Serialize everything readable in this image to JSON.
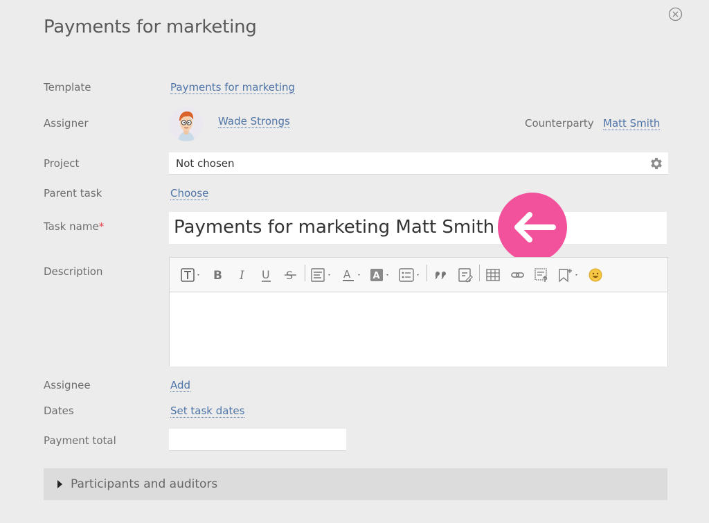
{
  "dialog": {
    "title": "Payments for marketing"
  },
  "fields": {
    "template": {
      "label": "Template",
      "value": "Payments for marketing"
    },
    "assigner": {
      "label": "Assigner",
      "name": "Wade Strongs"
    },
    "counterparty": {
      "label": "Counterparty",
      "name": "Matt Smith"
    },
    "project": {
      "label": "Project",
      "value": "Not chosen"
    },
    "parent_task": {
      "label": "Parent task",
      "action": "Choose"
    },
    "task_name": {
      "label": "Task name",
      "required_mark": "*",
      "value": "Payments for marketing Matt Smith"
    },
    "description": {
      "label": "Description"
    },
    "assignee": {
      "label": "Assignee",
      "action": "Add"
    },
    "dates": {
      "label": "Dates",
      "action": "Set task dates"
    },
    "payment_total": {
      "label": "Payment total",
      "value": ""
    }
  },
  "section": {
    "participants_label": "Participants and auditors"
  },
  "toolbar_icons": [
    "text-style-icon",
    "bold-icon",
    "italic-icon",
    "underline-icon",
    "strikethrough-icon",
    "align-icon",
    "font-color-icon",
    "highlight-icon",
    "list-icon",
    "quote-icon",
    "insert-code-icon",
    "table-icon",
    "link-icon",
    "attachment-icon",
    "bookmark-icon",
    "emoji-icon"
  ],
  "colors": {
    "background": "#ececec",
    "link": "#4f75a8",
    "accent_pink": "#f2519b",
    "required": "#e5484d"
  }
}
